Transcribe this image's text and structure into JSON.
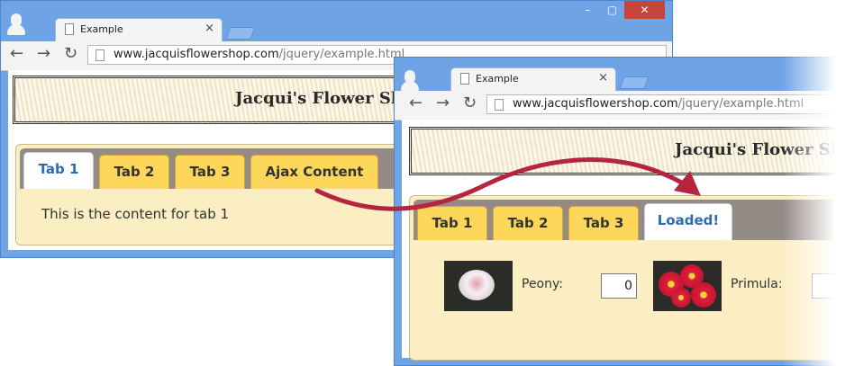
{
  "browser_tab": {
    "title": "Example",
    "close": "×"
  },
  "address": {
    "host": "www.jacquisflowershop.com",
    "path": "/jquery/example.html"
  },
  "window_controls": {
    "minimize": "–",
    "maximize": "▢",
    "close": "✕"
  },
  "nav": {
    "back": "←",
    "forward": "→",
    "reload": "↻"
  },
  "banner": {
    "title": "Jacqui's Flower Shop"
  },
  "before": {
    "tabs": [
      "Tab 1",
      "Tab 2",
      "Tab 3",
      "Ajax Content"
    ],
    "active_tab": "Tab 1",
    "content": "This is the content for tab 1"
  },
  "after": {
    "tabs": [
      "Tab 1",
      "Tab 2",
      "Tab 3",
      "Loaded!"
    ],
    "active_tab": "Loaded!",
    "products": [
      {
        "label": "Peony:",
        "value": "0",
        "icon": "peony-image"
      },
      {
        "label": "Primula:",
        "value": "",
        "icon": "primula-image"
      }
    ]
  },
  "colors": {
    "window_frame": "#6ea3e6",
    "tab_bar": "#948a86",
    "tab_inactive": "#fcd75a",
    "tab_active_text": "#2e6ab1",
    "panel": "#fbeec3",
    "arrow": "#b5253f"
  }
}
